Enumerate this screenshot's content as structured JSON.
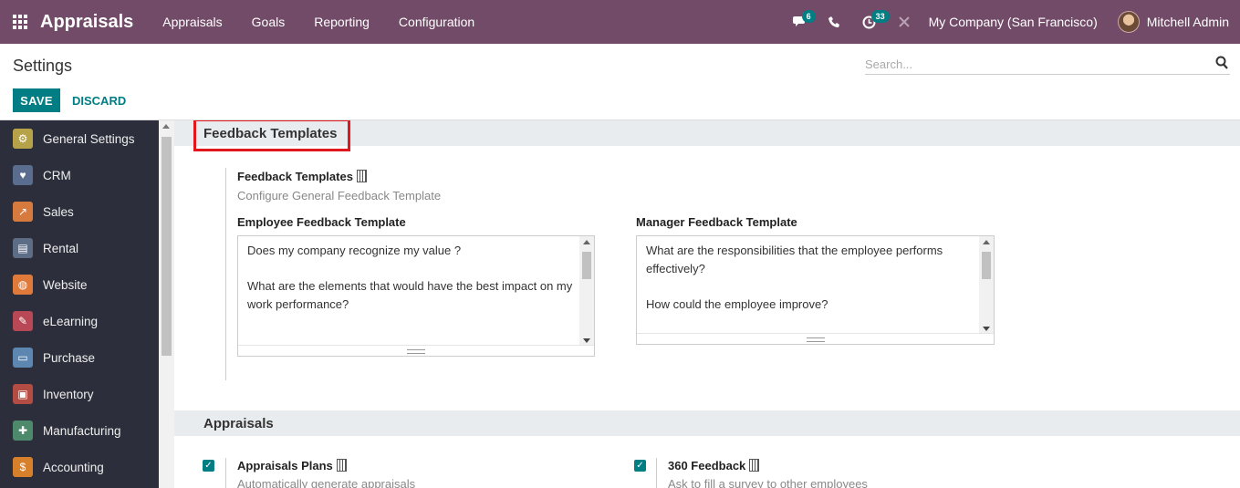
{
  "navbar": {
    "app_title": "Appraisals",
    "menu": [
      "Appraisals",
      "Goals",
      "Reporting",
      "Configuration"
    ],
    "messages_count": "6",
    "activities_count": "33",
    "company": "My Company (San Francisco)",
    "user": "Mitchell Admin",
    "accent": "#714b67"
  },
  "control": {
    "breadcrumb": "Settings",
    "search_placeholder": "Search...",
    "save_label": "SAVE",
    "discard_label": "DISCARD"
  },
  "sidebar": {
    "items": [
      {
        "label": "General Settings",
        "color": "#b6a249",
        "glyph": "⚙"
      },
      {
        "label": "CRM",
        "color": "#5b6d8e",
        "glyph": "♥"
      },
      {
        "label": "Sales",
        "color": "#d77a3e",
        "glyph": "↗"
      },
      {
        "label": "Rental",
        "color": "#5e6d86",
        "glyph": "▤"
      },
      {
        "label": "Website",
        "color": "#e07a3a",
        "glyph": "◍"
      },
      {
        "label": "eLearning",
        "color": "#b84855",
        "glyph": "✎"
      },
      {
        "label": "Purchase",
        "color": "#5d86b0",
        "glyph": "▭"
      },
      {
        "label": "Inventory",
        "color": "#b34d44",
        "glyph": "▣"
      },
      {
        "label": "Manufacturing",
        "color": "#4d8a6b",
        "glyph": "✚"
      },
      {
        "label": "Accounting",
        "color": "#d6802c",
        "glyph": "$"
      }
    ]
  },
  "feedback": {
    "section_title": "Feedback Templates",
    "setting_title": "Feedback Templates",
    "setting_desc": "Configure General Feedback Template",
    "employee_label": "Employee Feedback Template",
    "employee_lines": [
      "Does my company recognize my value ?",
      "What are the elements that would have the best impact on my work performance?"
    ],
    "manager_label": "Manager Feedback Template",
    "manager_lines": [
      "What are the responsibilities that the employee performs effectively?",
      "How could the employee improve?"
    ]
  },
  "appraisals": {
    "section_title": "Appraisals",
    "plans_title": "Appraisals Plans",
    "plans_desc": "Automatically generate appraisals",
    "plans_checked": true,
    "f360_title": "360 Feedback",
    "f360_desc": "Ask to fill a survey to other employees",
    "f360_checked": true
  }
}
